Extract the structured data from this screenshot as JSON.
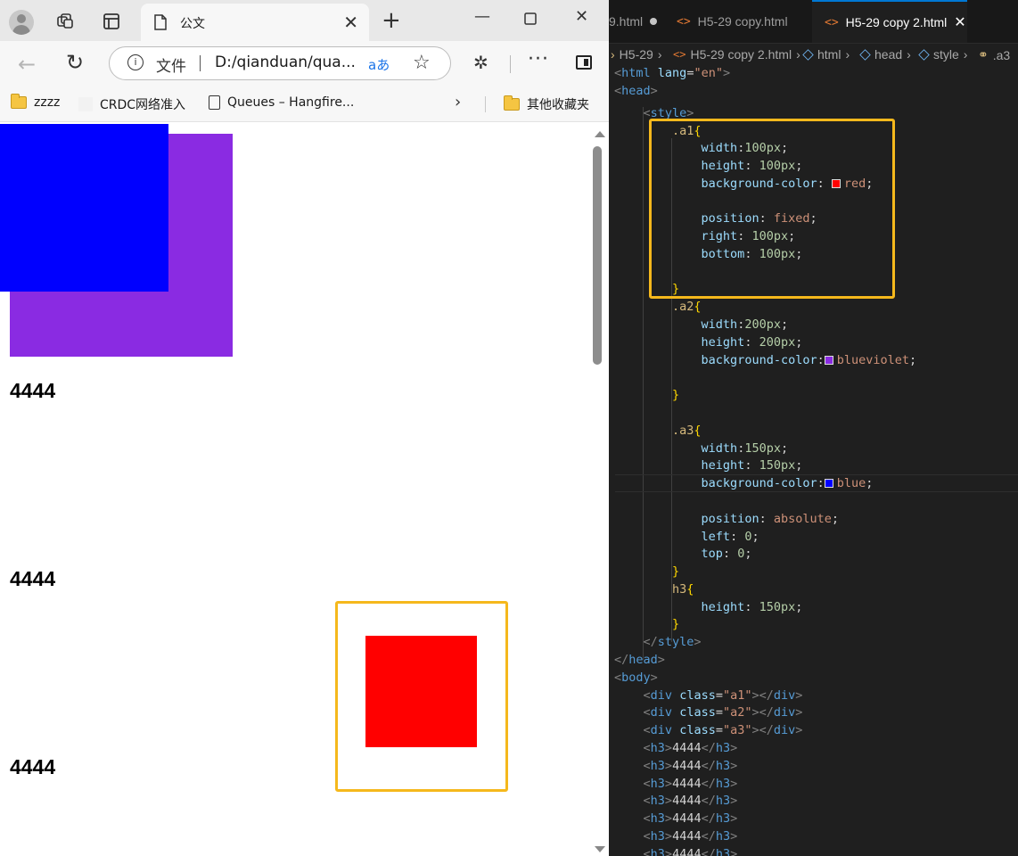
{
  "browser": {
    "tab_title": "公文",
    "omnibox": {
      "label": "文件",
      "url": "D:/qianduan/qua...",
      "read_aloud": "aあ"
    },
    "bookmarks": [
      "zzzz",
      "CRDC网络准入",
      "Queues – Hangfire...",
      "其他收藏夹"
    ],
    "page": {
      "headings": [
        "4444",
        "4444",
        "4444"
      ],
      "colors": {
        "a1": "#ff0000",
        "a2": "#8a2be2",
        "a3": "#0000ff",
        "highlight": "#f5b81c"
      }
    }
  },
  "editor": {
    "tabs": [
      {
        "name": "9.html",
        "modified": true
      },
      {
        "name": "H5-29 copy.html"
      },
      {
        "name": "H5-29 copy 2.html",
        "active": true
      }
    ],
    "breadcrumbs": [
      "H5-29",
      "H5-29 copy 2.html",
      "html",
      "head",
      "style",
      ".a3"
    ],
    "code": {
      "l1_tag": "html",
      "l1_attr": "lang",
      "l1_val": "\"en\"",
      "l2_tag": "head",
      "l3_tag": "style",
      "a1_sel": ".a1",
      "a1_width_prop": "width",
      "a1_width_val": "100px",
      "a1_height_prop": "height",
      "a1_height_val": "100px",
      "a1_bg_prop": "background-color",
      "a1_bg_val": "red",
      "a1_pos_prop": "position",
      "a1_pos_val": "fixed",
      "a1_right_prop": "right",
      "a1_right_val": "100px",
      "a1_bottom_prop": "bottom",
      "a1_bottom_val": "100px",
      "a2_sel": ".a2",
      "a2_width_prop": "width",
      "a2_width_val": "200px",
      "a2_height_prop": "height",
      "a2_height_val": "200px",
      "a2_bg_prop": "background-color",
      "a2_bg_val": "blueviolet",
      "a3_sel": ".a3",
      "a3_width_prop": "width",
      "a3_width_val": "150px",
      "a3_height_prop": "height",
      "a3_height_val": "150px",
      "a3_bg_prop": "background-color",
      "a3_bg_val": "blue",
      "a3_pos_prop": "position",
      "a3_pos_val": "absolute",
      "a3_left_prop": "left",
      "a3_left_val": "0",
      "a3_top_prop": "top",
      "a3_top_val": "0",
      "h3_sel": "h3",
      "h3_height_prop": "height",
      "h3_height_val": "150px",
      "style_close": "style",
      "head_close": "head",
      "body_tag": "body",
      "div_tag": "div",
      "class_attr": "class",
      "div1_class": "\"a1\"",
      "div2_class": "\"a2\"",
      "div3_class": "\"a3\"",
      "h3_tag": "h3",
      "h3_text": "4444"
    }
  }
}
